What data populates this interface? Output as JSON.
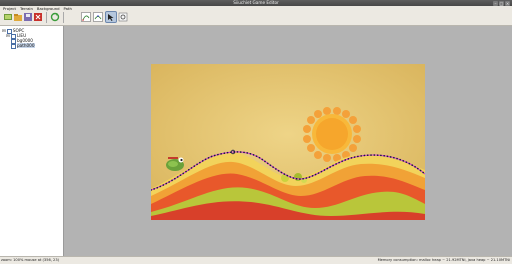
{
  "window": {
    "title": "Siiuchiet Game Editor"
  },
  "menu": [
    "Project",
    "Terrain",
    "Background",
    "Path"
  ],
  "tree": {
    "root": "SOPC",
    "child": "LIEU",
    "items": [
      "bg0000",
      "path000"
    ]
  },
  "status": {
    "left": "zoom: 100% mouse at (356, 23)",
    "right": "Memory consumption: malloc heap ~ 21.92MTNi, java heap ~ 21.10MTNi"
  },
  "colors": {
    "sky": "#e6c86e",
    "sun": "#f2a640",
    "path_dot": "#1a1a40",
    "path_line": "#d24acb"
  },
  "icons": [
    "new-icon",
    "open-icon",
    "save-icon",
    "close-icon",
    "refresh-icon",
    "edit-path-icon",
    "edit-node-icon",
    "select-icon",
    "settings-icon"
  ]
}
